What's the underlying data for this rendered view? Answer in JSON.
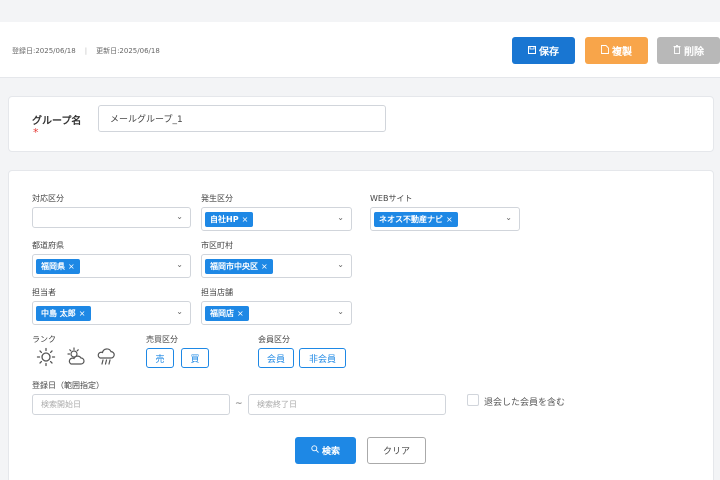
{
  "header": {
    "registered_label": "登録日:2025/06/18",
    "updated_label": "更新日:2025/06/18",
    "separator": "|",
    "save_label": "保存",
    "copy_label": "複製",
    "delete_label": "削除"
  },
  "group": {
    "name_label": "グループ名",
    "required_mark": "*",
    "name_value": "メールグループ_1"
  },
  "filters": {
    "taiou_label": "対応区分",
    "hassei_label": "発生区分",
    "hassei_tag": "自社HP",
    "web_label": "WEBサイト",
    "web_tag": "ネオス不動産ナビ",
    "pref_label": "都道府県",
    "pref_tag": "福岡県",
    "city_label": "市区町村",
    "city_tag": "福岡市中央区",
    "staff_label": "担当者",
    "staff_tag": "中島 太郎",
    "store_label": "担当店舗",
    "store_tag": "福岡店",
    "rank_label": "ランク",
    "rank_icons": [
      "sun-icon",
      "partly-cloudy-icon",
      "rain-icon"
    ],
    "baibai_label": "売買区分",
    "baibai_options": [
      "売",
      "買"
    ],
    "member_label": "会員区分",
    "member_options": [
      "会員",
      "非会員"
    ],
    "reg_date_label": "登録日（範囲指定）",
    "start_placeholder": "検索開始日",
    "range_sep": "~",
    "end_placeholder": "検索終了日",
    "withdrawn_label": "退会した会員を含む",
    "tag_remove": "×",
    "search_label": "検索",
    "clear_label": "クリア"
  },
  "colors": {
    "primary": "#1976d2",
    "tag": "#1e88e5",
    "copy": "#f8a54a",
    "delete": "#b8b8b8",
    "required": "#e53935"
  }
}
